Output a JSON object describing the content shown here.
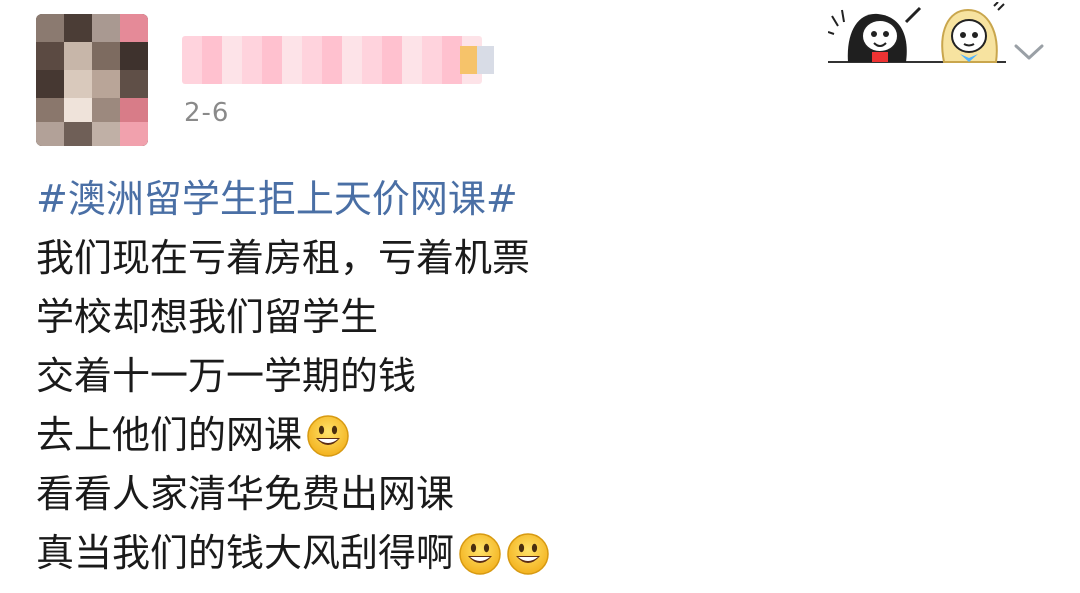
{
  "post": {
    "date": "2-6",
    "hashtag": "#澳洲留学生拒上天价网课#",
    "lines": [
      "我们现在亏着房租，亏着机票",
      "学校却想我们留学生",
      "交着十一万一学期的钱",
      "去上他们的网课",
      "看看人家清华免费出网课",
      "真当我们的钱大风刮得啊"
    ],
    "emoji_after_line_4": [
      "grinning-face"
    ],
    "emoji_after_line_6": [
      "grinning-face",
      "grinning-face"
    ]
  },
  "colors": {
    "hashtag": "#4a6fa5",
    "text": "#1a1a1a",
    "date": "#8a8a8a",
    "background": "#ffffff"
  },
  "icons": {
    "header_decoration": "cartoon-characters-icon",
    "menu": "chevron-down-icon"
  }
}
